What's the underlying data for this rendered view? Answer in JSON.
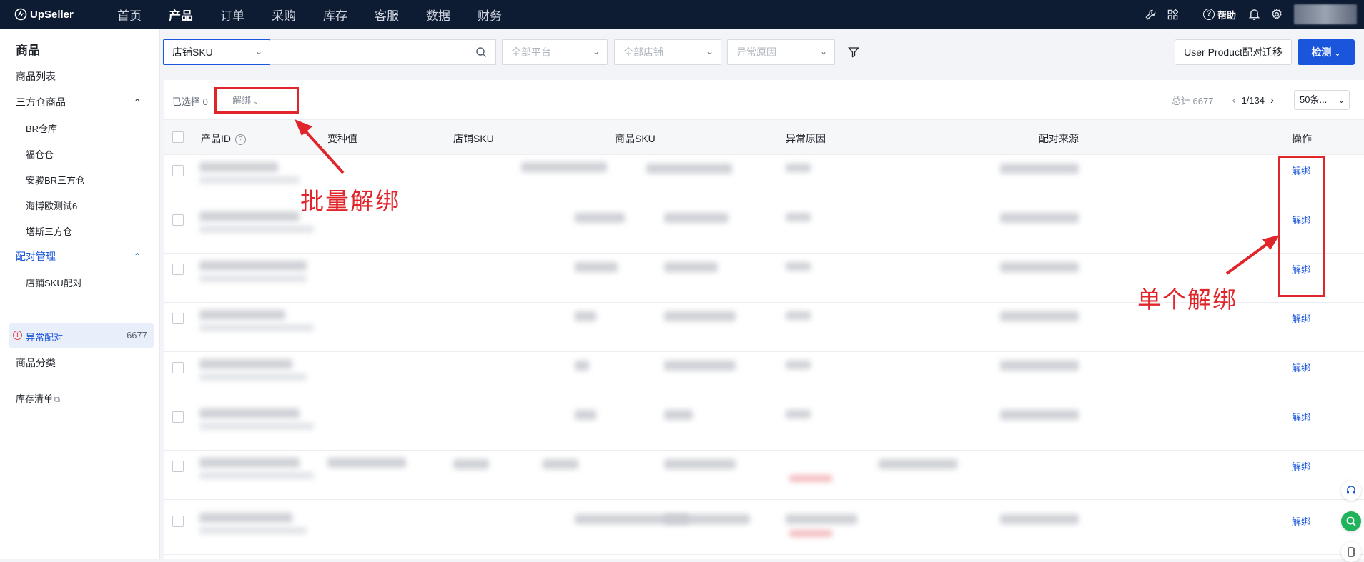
{
  "topbar": {
    "brand": "UpSeller",
    "nav": [
      "首页",
      "产品",
      "订单",
      "采购",
      "库存",
      "客服",
      "数据",
      "财务"
    ],
    "active_index": 1,
    "help": "帮助"
  },
  "sidebar": {
    "title": "商品",
    "product_list": "商品列表",
    "third_party": "三方仓商品",
    "third_party_items": [
      "BR仓库",
      "福仓仓",
      "安骏BR三方仓",
      "海博欧测试6",
      "塔斯三方仓"
    ],
    "pairing": "配对管理",
    "store_sku_pairing": "店铺SKU配对",
    "abnormal_pairing": "异常配对",
    "abnormal_count": "6677",
    "category": "商品分类",
    "inventory": "库存清单"
  },
  "filters": {
    "sku_type": "店铺SKU",
    "search_placeholder": "",
    "platform": "全部平台",
    "store": "全部店铺",
    "reason": "异常原因",
    "migrate_button": "User Product配对迁移",
    "detect_button": "检测"
  },
  "toolbar": {
    "selected_label": "已选择",
    "selected_count": "0",
    "batch_unbind": "解绑",
    "total": "总计 6677",
    "page": "1/134",
    "page_size": "50条..."
  },
  "table": {
    "columns": [
      "产品ID",
      "变种值",
      "店铺SKU",
      "商品SKU",
      "异常原因",
      "配对来源",
      "操作"
    ],
    "row_action": "解绑",
    "row_count": 8
  },
  "annotations": {
    "batch": "批量解绑",
    "single": "单个解绑"
  },
  "colors": {
    "nav_bg": "#0d1b33",
    "accent": "#1a56db",
    "annotation": "#e0252b"
  }
}
